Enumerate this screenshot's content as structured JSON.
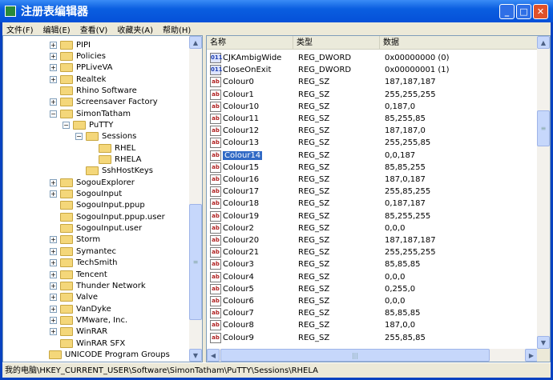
{
  "title": "注册表编辑器",
  "menu": [
    "文件(F)",
    "编辑(E)",
    "查看(V)",
    "收藏夹(A)",
    "帮助(H)"
  ],
  "tree": [
    {
      "label": "PIPI",
      "level": 0,
      "exp": "+"
    },
    {
      "label": "Policies",
      "level": 0,
      "exp": "+"
    },
    {
      "label": "PPLiveVA",
      "level": 0,
      "exp": "+"
    },
    {
      "label": "Realtek",
      "level": 0,
      "exp": "+"
    },
    {
      "label": "Rhino Software",
      "level": 0,
      "exp": ""
    },
    {
      "label": "Screensaver Factory",
      "level": 0,
      "exp": "+"
    },
    {
      "label": "SimonTatham",
      "level": 0,
      "exp": "-"
    },
    {
      "label": "PuTTY",
      "level": 1,
      "exp": "-"
    },
    {
      "label": "Sessions",
      "level": 2,
      "exp": "-"
    },
    {
      "label": "RHEL",
      "level": 3,
      "exp": ""
    },
    {
      "label": "RHELA",
      "level": 3,
      "exp": ""
    },
    {
      "label": "SshHostKeys",
      "level": 2,
      "exp": ""
    },
    {
      "label": "SogouExplorer",
      "level": 0,
      "exp": "+"
    },
    {
      "label": "SogouInput",
      "level": 0,
      "exp": "+"
    },
    {
      "label": "SogouInput.ppup",
      "level": 0,
      "exp": ""
    },
    {
      "label": "SogouInput.ppup.user",
      "level": 0,
      "exp": ""
    },
    {
      "label": "SogouInput.user",
      "level": 0,
      "exp": ""
    },
    {
      "label": "Storm",
      "level": 0,
      "exp": "+"
    },
    {
      "label": "Symantec",
      "level": 0,
      "exp": "+"
    },
    {
      "label": "TechSmith",
      "level": 0,
      "exp": "+"
    },
    {
      "label": "Tencent",
      "level": 0,
      "exp": "+"
    },
    {
      "label": "Thunder Network",
      "level": 0,
      "exp": "+"
    },
    {
      "label": "Valve",
      "level": 0,
      "exp": "+"
    },
    {
      "label": "VanDyke",
      "level": 0,
      "exp": "+"
    },
    {
      "label": "VMware, Inc.",
      "level": 0,
      "exp": "+"
    },
    {
      "label": "WinRAR",
      "level": 0,
      "exp": "+"
    },
    {
      "label": "WinRAR SFX",
      "level": 0,
      "exp": ""
    },
    {
      "label": "UNICODE Program Groups",
      "level": -1,
      "exp": ""
    }
  ],
  "columns": [
    "名称",
    "类型",
    "数据"
  ],
  "values": [
    {
      "name": "CJKAmbigWide",
      "type": "REG_DWORD",
      "data": "0x00000000 (0)",
      "icon": "dw"
    },
    {
      "name": "CloseOnExit",
      "type": "REG_DWORD",
      "data": "0x00000001 (1)",
      "icon": "dw"
    },
    {
      "name": "Colour0",
      "type": "REG_SZ",
      "data": "187,187,187",
      "icon": "sz"
    },
    {
      "name": "Colour1",
      "type": "REG_SZ",
      "data": "255,255,255",
      "icon": "sz"
    },
    {
      "name": "Colour10",
      "type": "REG_SZ",
      "data": "0,187,0",
      "icon": "sz"
    },
    {
      "name": "Colour11",
      "type": "REG_SZ",
      "data": "85,255,85",
      "icon": "sz"
    },
    {
      "name": "Colour12",
      "type": "REG_SZ",
      "data": "187,187,0",
      "icon": "sz"
    },
    {
      "name": "Colour13",
      "type": "REG_SZ",
      "data": "255,255,85",
      "icon": "sz"
    },
    {
      "name": "Colour14",
      "type": "REG_SZ",
      "data": "0,0,187",
      "icon": "sz",
      "selected": true
    },
    {
      "name": "Colour15",
      "type": "REG_SZ",
      "data": "85,85,255",
      "icon": "sz"
    },
    {
      "name": "Colour16",
      "type": "REG_SZ",
      "data": "187,0,187",
      "icon": "sz"
    },
    {
      "name": "Colour17",
      "type": "REG_SZ",
      "data": "255,85,255",
      "icon": "sz"
    },
    {
      "name": "Colour18",
      "type": "REG_SZ",
      "data": "0,187,187",
      "icon": "sz"
    },
    {
      "name": "Colour19",
      "type": "REG_SZ",
      "data": "85,255,255",
      "icon": "sz"
    },
    {
      "name": "Colour2",
      "type": "REG_SZ",
      "data": "0,0,0",
      "icon": "sz"
    },
    {
      "name": "Colour20",
      "type": "REG_SZ",
      "data": "187,187,187",
      "icon": "sz"
    },
    {
      "name": "Colour21",
      "type": "REG_SZ",
      "data": "255,255,255",
      "icon": "sz"
    },
    {
      "name": "Colour3",
      "type": "REG_SZ",
      "data": "85,85,85",
      "icon": "sz"
    },
    {
      "name": "Colour4",
      "type": "REG_SZ",
      "data": "0,0,0",
      "icon": "sz"
    },
    {
      "name": "Colour5",
      "type": "REG_SZ",
      "data": "0,255,0",
      "icon": "sz"
    },
    {
      "name": "Colour6",
      "type": "REG_SZ",
      "data": "0,0,0",
      "icon": "sz"
    },
    {
      "name": "Colour7",
      "type": "REG_SZ",
      "data": "85,85,85",
      "icon": "sz"
    },
    {
      "name": "Colour8",
      "type": "REG_SZ",
      "data": "187,0,0",
      "icon": "sz"
    },
    {
      "name": "Colour9",
      "type": "REG_SZ",
      "data": "255,85,85",
      "icon": "sz"
    }
  ],
  "status": "我的电脑\\HKEY_CURRENT_USER\\Software\\SimonTatham\\PuTTY\\Sessions\\RHELA"
}
